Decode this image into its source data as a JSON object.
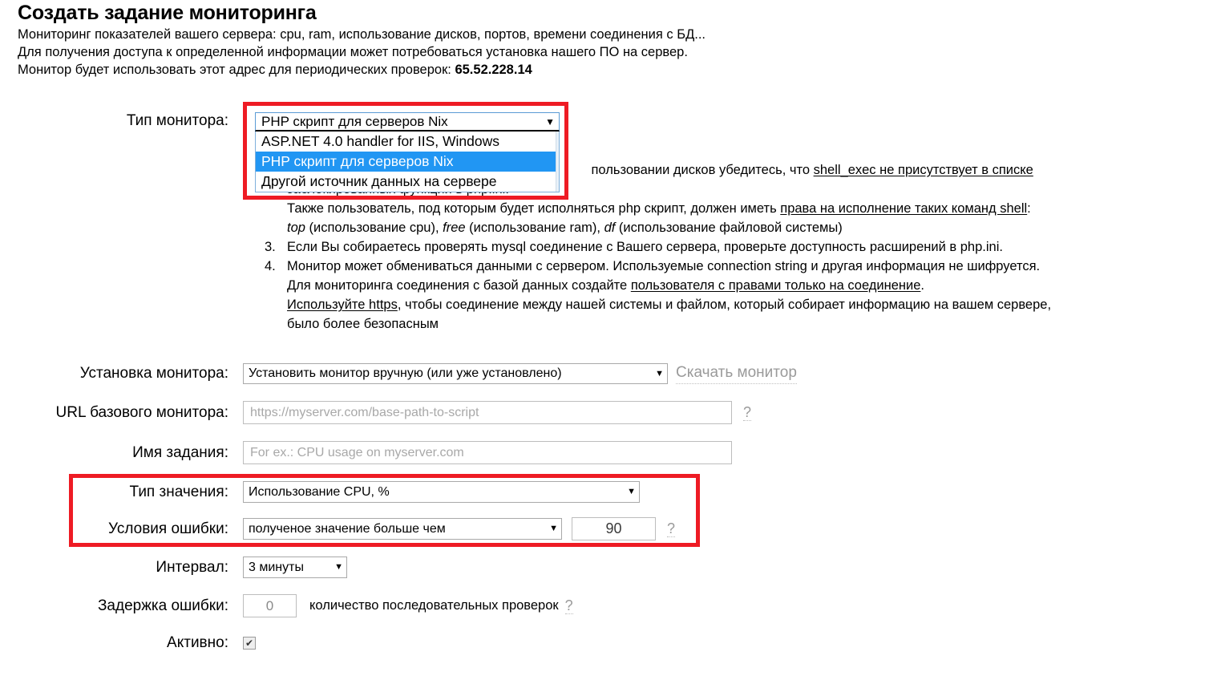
{
  "page": {
    "title": "Создать задание мониторинга",
    "intro_lines": [
      "Мониторинг показателей вашего сервера: cpu, ram, использование дисков, портов, времени соединения с БД...",
      "Для получения доступа к определенной информации может потребоваться установка нашего ПО на сервер.",
      "Монитор будет использовать этот адрес для периодических проверок: "
    ],
    "monitor_ip": "65.52.228.14"
  },
  "monitor_type": {
    "label": "Тип монитора:",
    "selected": "PHP скрипт для серверов Nix",
    "options": [
      "ASP.NET 4.0 handler for IIS, Windows",
      "PHP скрипт для серверов Nix",
      "Другой источник данных на сервере"
    ],
    "selected_index": 1,
    "caret": "▼"
  },
  "instructions": {
    "obscured_line_2": "заблокированных функций в php.ini.",
    "line_2_tail": "пользовании дисков убедитесь, что ",
    "line_2_link": "shell_exec не присутствует в списке",
    "para_a_1": "Также пользователь, под которым будет исполняться php скрипт, должен иметь ",
    "para_a_1_link": "права на исполнение таких команд shell",
    "para_a_1_tail": ":",
    "para_a_2_parts": {
      "i1": "top",
      "t1": " (использование cpu), ",
      "i2": "free",
      "t2": " (использование ram), ",
      "i3": "df",
      "t3": " (использование файловой системы)"
    },
    "item3_num": "3.",
    "item3": "Если Вы собираетесь проверять mysql соединение с Вашего сервера, проверьте доступность расширений в php.ini.",
    "item4_num": "4.",
    "item4_l1": "Монитор может обмениваться данными с сервером. Используемые connection string и другая информация не шифруется.",
    "item4_l2_head": "Для мониторинга соединения с базой данных создайте ",
    "item4_l2_link": "пользователя с правами только на соединение",
    "item4_l2_tail": ".",
    "item4_l3_link": "Используйте https",
    "item4_l3_tail": ", чтобы соединение между нашей системы и файлом, который собирает информацию на вашем сервере,",
    "item4_l4": "было более безопасным"
  },
  "install": {
    "label": "Установка монитора:",
    "selected": "Установить монитор вручную (или уже установлено)",
    "caret": "▼",
    "download_link": "Скачать монитор"
  },
  "base_url": {
    "label": "URL базового монитора:",
    "value": "",
    "placeholder": "https://myserver.com/base-path-to-script",
    "help": "?"
  },
  "job_name": {
    "label": "Имя задания:",
    "value": "",
    "placeholder": "For ex.: CPU usage on myserver.com"
  },
  "value_type": {
    "label": "Тип значения:",
    "selected": "Использование CPU, %",
    "caret": "▼"
  },
  "error_condition": {
    "label": "Условия ошибки:",
    "selected": "полученое значение больше чем",
    "caret": "▼",
    "threshold": "90",
    "help": "?"
  },
  "interval": {
    "label": "Интервал:",
    "selected": "3 минуты",
    "caret": "▼"
  },
  "error_delay": {
    "label": "Задержка ошибки:",
    "value": "0",
    "hint": "количество последовательных проверок",
    "help": "?"
  },
  "active": {
    "label": "Активно:",
    "checked": true,
    "check_glyph": "✔"
  },
  "colors": {
    "highlight_red": "#ee1b24",
    "selected_blue": "#2196f3",
    "muted_gray": "#9a9a9a"
  }
}
